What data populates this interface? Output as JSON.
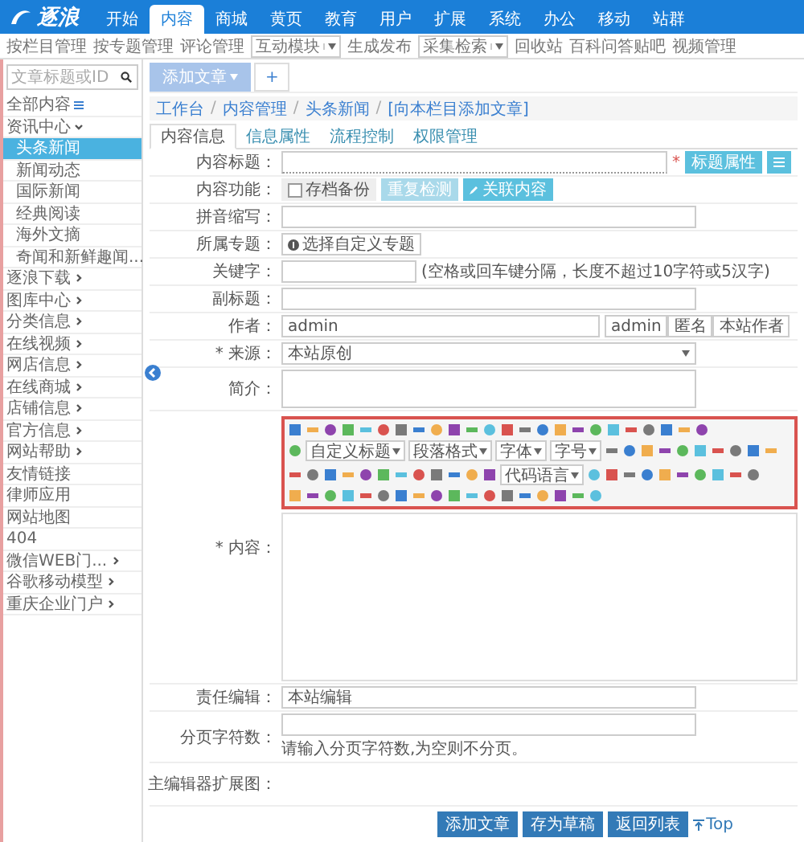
{
  "logo": "逐浪",
  "nav": [
    {
      "label": "开始",
      "selected": false
    },
    {
      "label": "内容",
      "selected": true
    },
    {
      "label": "商城",
      "selected": false
    },
    {
      "label": "黄页",
      "selected": false
    },
    {
      "label": "教育",
      "selected": false
    },
    {
      "label": "用户",
      "selected": false
    },
    {
      "label": "扩展",
      "selected": false
    },
    {
      "label": "系统",
      "selected": false
    },
    {
      "label": "办公",
      "selected": false
    },
    {
      "label": "移动",
      "selected": false
    },
    {
      "label": "站群",
      "selected": false
    }
  ],
  "subnav": [
    {
      "kind": "link",
      "label": "按栏目管理"
    },
    {
      "kind": "link",
      "label": "按专题管理"
    },
    {
      "kind": "link",
      "label": "评论管理"
    },
    {
      "kind": "dropdown",
      "label": "互动模块"
    },
    {
      "kind": "link",
      "label": "生成发布"
    },
    {
      "kind": "dropdown",
      "label": "采集检索"
    },
    {
      "kind": "link",
      "label": "回收站"
    },
    {
      "kind": "link",
      "label": "百科问答贴吧"
    },
    {
      "kind": "link",
      "label": "视频管理"
    }
  ],
  "sidebar": {
    "search": {
      "placeholder": "文章标题或ID"
    },
    "items": [
      {
        "kind": "all",
        "label": "全部内容"
      },
      {
        "kind": "folder",
        "label": "资讯中心",
        "expanded": true,
        "children": [
          {
            "label": "头条新闻",
            "selected": true
          },
          {
            "label": "新闻动态",
            "selected": false
          },
          {
            "label": "国际新闻",
            "selected": false
          },
          {
            "label": "经典阅读",
            "selected": false
          },
          {
            "label": "海外文摘",
            "selected": false
          },
          {
            "label": "奇闻和新鲜趣闻...",
            "selected": false
          }
        ]
      },
      {
        "kind": "folder",
        "label": "逐浪下载",
        "expanded": false
      },
      {
        "kind": "folder",
        "label": "图库中心",
        "expanded": false
      },
      {
        "kind": "folder",
        "label": "分类信息",
        "expanded": false
      },
      {
        "kind": "folder",
        "label": "在线视频",
        "expanded": false
      },
      {
        "kind": "folder",
        "label": "网店信息",
        "expanded": false
      },
      {
        "kind": "folder",
        "label": "在线商城",
        "expanded": false
      },
      {
        "kind": "folder",
        "label": "店铺信息",
        "expanded": false
      },
      {
        "kind": "folder",
        "label": "官方信息",
        "expanded": false
      },
      {
        "kind": "folder",
        "label": "网站帮助",
        "expanded": false
      },
      {
        "kind": "leaf",
        "label": "友情链接"
      },
      {
        "kind": "leaf",
        "label": "律师应用"
      },
      {
        "kind": "leaf",
        "label": "网站地图"
      },
      {
        "kind": "leaf",
        "label": "404"
      },
      {
        "kind": "folder",
        "label": "微信WEB门...",
        "expanded": false
      },
      {
        "kind": "folder",
        "label": "谷歌移动模型",
        "expanded": false
      },
      {
        "kind": "folder",
        "label": "重庆企业门户",
        "expanded": false
      }
    ]
  },
  "page_tabs": [
    {
      "label": "添加文章",
      "selected": true
    }
  ],
  "add_tab": "+",
  "breadcrumb": {
    "separator": "/",
    "items": [
      "工作台",
      "内容管理",
      "头条新闻",
      "[向本栏目添加文章]"
    ]
  },
  "tabs": [
    {
      "label": "内容信息",
      "selected": true
    },
    {
      "label": "信息属性",
      "selected": false
    },
    {
      "label": "流程控制",
      "selected": false
    },
    {
      "label": "权限管理",
      "selected": false
    }
  ],
  "form": [
    {
      "kind": "title",
      "label": "内容标题：",
      "mark": "*",
      "button": "标题属性"
    },
    {
      "kind": "functions",
      "label": "内容功能：",
      "checkbox": {
        "label": "存档备份",
        "checked": false
      },
      "buttons": [
        "重复检测",
        "关联内容"
      ]
    },
    {
      "kind": "input",
      "label": "拼音缩写："
    },
    {
      "kind": "topic",
      "label": "所属专题：",
      "button": "选择自定义专题"
    },
    {
      "kind": "keyword",
      "label": "关键字：",
      "hint": "(空格或回车键分隔，长度不超过10字符或5汉字)"
    },
    {
      "kind": "input",
      "label": "副标题："
    },
    {
      "kind": "author",
      "label": "作者：",
      "value": "admin",
      "buttons": [
        "admin",
        "匿名",
        "本站作者"
      ]
    },
    {
      "kind": "select",
      "label": "* 来源：",
      "value": "本站原创"
    },
    {
      "kind": "textarea",
      "label": "简介："
    },
    {
      "kind": "editor",
      "label": "* 内容：",
      "dropdowns": [
        "自定义标题",
        "段落格式",
        "字体",
        "字号",
        "代码语言"
      ]
    },
    {
      "kind": "input",
      "label": "责任编辑：",
      "value": "本站编辑"
    },
    {
      "kind": "note",
      "label": "分页字符数：",
      "note": "请输入分页字符数,为空则不分页。"
    },
    {
      "kind": "blank",
      "label": "主编辑器扩展图："
    }
  ],
  "actions": [
    "添加文章",
    "存为草稿",
    "返回列表"
  ],
  "top_link": "Top"
}
